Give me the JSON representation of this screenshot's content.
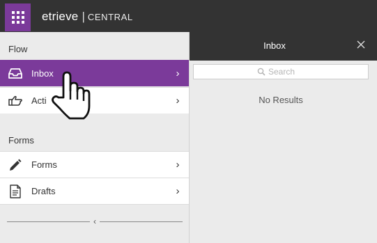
{
  "app": {
    "brand_name": "etrieve",
    "brand_divider": "|",
    "brand_product": "CENTRAL",
    "launcher_icon": "app-grid-icon"
  },
  "sidebar": {
    "flow_heading": "Flow",
    "forms_heading": "Forms",
    "flow_items": [
      {
        "label": "Inbox",
        "icon": "inbox-tray-icon",
        "active": true
      },
      {
        "label": "Acti",
        "icon": "pointing-hand-icon",
        "active": false
      }
    ],
    "forms_items": [
      {
        "label": "Forms",
        "icon": "pencil-icon",
        "active": false
      },
      {
        "label": "Drafts",
        "icon": "document-icon",
        "active": false
      }
    ],
    "chevron": "›",
    "collapse_arrow": "‹"
  },
  "panel": {
    "title": "Inbox",
    "search_placeholder": "Search",
    "empty_text": "No Results"
  },
  "colors": {
    "accent": "#7b3a9a",
    "topbar": "#333333",
    "sidebar_bg": "#ebebeb"
  },
  "cursor": "hand-pointer-icon"
}
